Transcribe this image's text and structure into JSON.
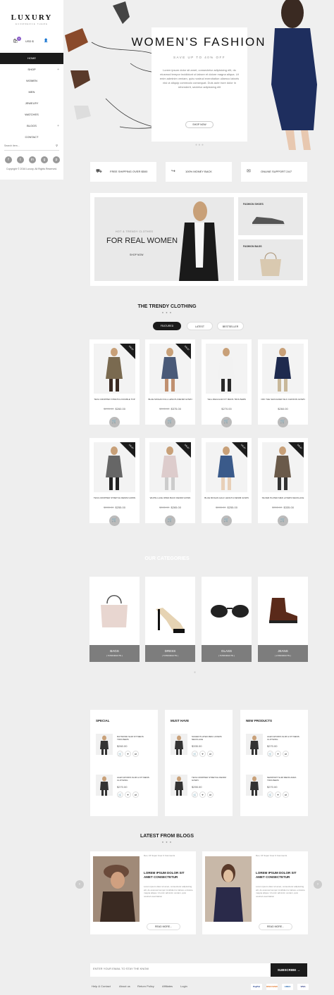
{
  "sidebar": {
    "logo": "LUXURY",
    "logo_sub": "ECOMMERCE THEME",
    "cart_count": "0",
    "currency": "USD $",
    "nav": [
      {
        "label": "HOME",
        "chevron": ""
      },
      {
        "label": "SHOP",
        "chevron": "+"
      },
      {
        "label": "WOMEN",
        "chevron": ""
      },
      {
        "label": "MEN",
        "chevron": ""
      },
      {
        "label": "JEWELRY",
        "chevron": ""
      },
      {
        "label": "WATCHES",
        "chevron": ""
      },
      {
        "label": "BLOGS",
        "chevron": "+"
      },
      {
        "label": "CONTACT",
        "chevron": ""
      }
    ],
    "search_placeholder": "Search item...",
    "social": [
      "f",
      "t",
      "in",
      "g",
      "p"
    ],
    "copyright": "Copyright © 2016 Luxury. All Rights Reserved."
  },
  "hero": {
    "title": "WOMEN'S FASHION",
    "subtitle": "SAVE UP TO 40% OFF",
    "text": "Lorem ipsum dolor sit amet, consectetur adipisicing elit, do eiusmod tempor incididunt ut labore et dolore magna aliqua. Ut enim adminim veniam, quis nostrud exercitation ullamco laboris nisi ut aliquip commodo consequat. Duis aute irure dolor in rehenderit, sectetur adipisicing elit",
    "button": "SHOP NOW"
  },
  "features": [
    {
      "icon": "truck-icon",
      "glyph": "⛟",
      "label": "FREE SHIPPING OVER $500"
    },
    {
      "icon": "money-back-icon",
      "glyph": "↪",
      "label": "100% MONEY BACK"
    },
    {
      "icon": "chat-icon",
      "glyph": "✉",
      "label": "ONLINE SUPPORT 24/7"
    }
  ],
  "promo": {
    "kicker": "HOT & TRENDY CLOTHES",
    "title": "FOR REAL WOMEN",
    "button": "SHOP NOW",
    "side": [
      {
        "label": "FASHION SHOES"
      },
      {
        "label": "FASHION BAGS"
      }
    ]
  },
  "trendy": {
    "title": "THE TRENDY CLOTHING",
    "tabs": [
      "FEATURED",
      "LATEST",
      "BESTSELLER"
    ],
    "sale_label": "SALE!",
    "products": [
      {
        "name": "TEXA CROPPED STRETCH DOUBLE TOP",
        "old": "$295.00",
        "price": "$260.00",
        "sale": true
      },
      {
        "name": "BLUE MOGAN FULL LENGTH DENIM GOWN",
        "old": "$395.00",
        "price": "$375.00",
        "sale": true
      },
      {
        "name": "YELL REGULAR FIT MENS TROUSERS",
        "old": "",
        "price": "$270.00",
        "sale": false
      },
      {
        "name": "OFF THE SHOULDER SILK CHIFFON GOWN",
        "old": "",
        "price": "$260.00",
        "sale": false
      },
      {
        "name": "TEXA CROPPED STRETCH DENIM GOWN",
        "old": "$285.00",
        "price": "$255.00",
        "sale": true
      },
      {
        "name": "WHITE LACE OPEN BACK DENIM GOWN",
        "old": "$285.00",
        "price": "$265.00",
        "sale": true
      },
      {
        "name": "BLUE MOGAN HALF LENGTH DENIM GOWN",
        "old": "$285.00",
        "price": "$255.00",
        "sale": true
      },
      {
        "name": "SILVER PLATED MEN LAYERS NECKLACE",
        "old": "$355.00",
        "price": "$335.00",
        "sale": true
      }
    ]
  },
  "categories": {
    "title": "OUR CATEGORIES",
    "items": [
      {
        "name": "BAGS",
        "count": "( 5 PRODUCTS )"
      },
      {
        "name": "DRESS",
        "count": "( 5 PRODUCTS )"
      },
      {
        "name": "GLASS",
        "count": "( 5 PRODUCTS )"
      },
      {
        "name": "JEANS",
        "count": "( 2 PRODUCTS )"
      }
    ]
  },
  "lists": [
    {
      "title": "SPECIAL",
      "items": [
        {
          "name": "RAYMOND SLIM FIT MENS TROUSERS",
          "price": "$260.00"
        },
        {
          "name": "ALEN WOODS SLIM & FIT MENS CLOTHING",
          "price": "$270.00"
        }
      ]
    },
    {
      "title": "MUST HAVE",
      "items": [
        {
          "name": "SILVER PLATED MEN LAYERS NECKLACE",
          "price": "$335.00"
        },
        {
          "name": "TEXA CROPPED STRETCH DENIM GOWN",
          "price": "$255.00"
        }
      ]
    },
    {
      "title": "NEW PRODUCTS",
      "items": [
        {
          "name": "ALEN WOODS SLIM & FIT MENS CLOTHING",
          "price": "$270.00"
        },
        {
          "name": "NEWPORT SLIM MENS ZARA TROUSERS",
          "price": "$270.00"
        }
      ]
    }
  ],
  "blogs": {
    "title": "LATEST FROM BLOGS",
    "posts": [
      {
        "date": "Dec, 15",
        "author": "Super User",
        "comments": "0 Comments",
        "title": "LOREM IPSUM DOLOR SIT AMET CONSECTETUR",
        "text": "Lorem ipsum dolor sit amet, consectetur adipisicing elit, do eiusmod tempor incididunt ut labore et dolore magna aliqua. Ut enim adminim veniam, quis nostrud exercitation",
        "button": "READ MORE..."
      },
      {
        "date": "Dec, 15",
        "author": "Super User",
        "comments": "0 Comments",
        "title": "LOREM IPSUM DOLOR SIT AMET CONSECTETUR",
        "text": "Lorem ipsum dolor sit amet, consectetur adipisicing elit, do eiusmod tempor incididunt ut labore et dolore magna aliqua. Ut enim adminim veniam, quis nostrud exercitation",
        "button": "READ MORE..."
      }
    ]
  },
  "newsletter": {
    "placeholder": "ENTER YOUR EMAIL TO STAY THE KNOW",
    "button": "SUBSCRIBE →"
  },
  "footer": {
    "links": [
      "Help & Contact",
      "About us",
      "Return Policy",
      "Affiliates",
      "Login"
    ],
    "payments": [
      "PayPal",
      "DISCOVER",
      "AMEX",
      "VISA"
    ]
  }
}
